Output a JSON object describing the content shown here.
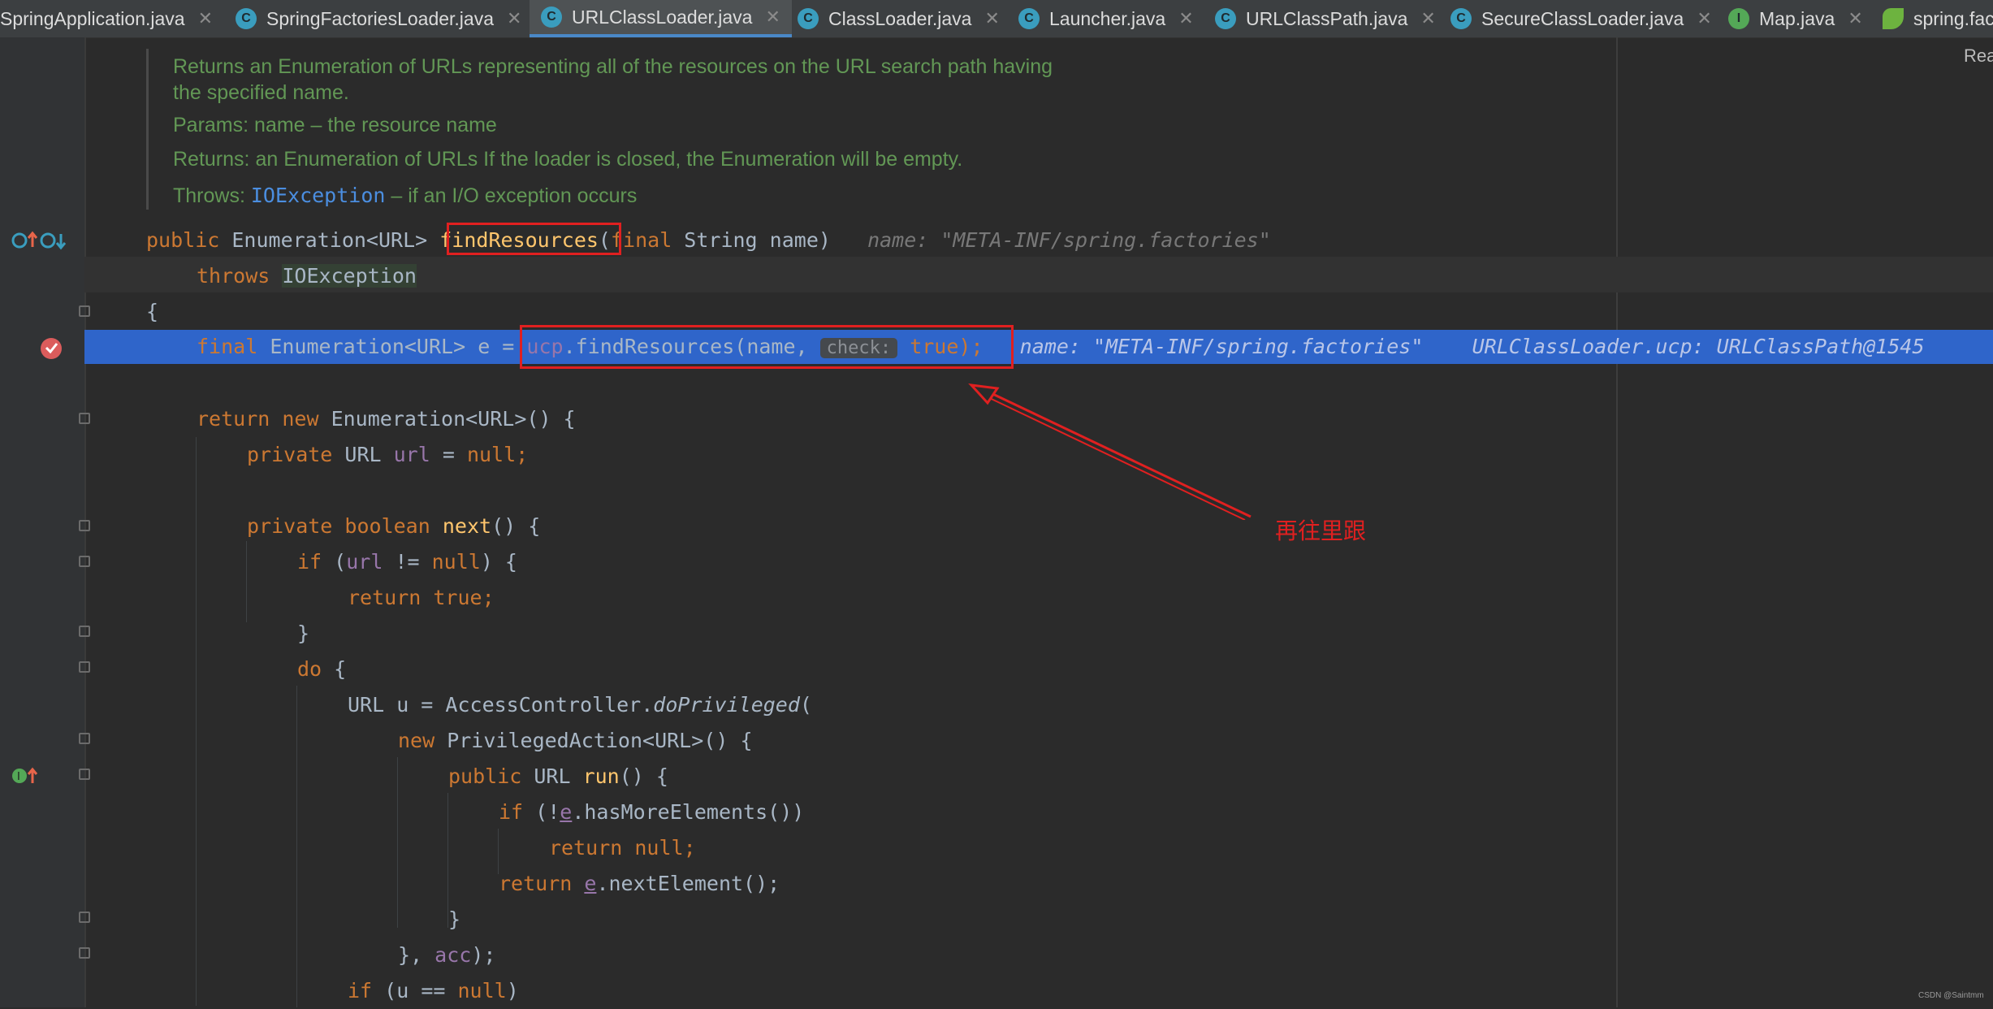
{
  "tabs": [
    {
      "label": "SpringApplication.java",
      "icon": "class-icon",
      "active": false
    },
    {
      "label": "SpringFactoriesLoader.java",
      "icon": "class-icon",
      "active": false
    },
    {
      "label": "URLClassLoader.java",
      "icon": "class-icon",
      "active": true
    },
    {
      "label": "ClassLoader.java",
      "icon": "class-icon",
      "active": false
    },
    {
      "label": "Launcher.java",
      "icon": "class-icon",
      "active": false
    },
    {
      "label": "URLClassPath.java",
      "icon": "class-icon",
      "active": false
    },
    {
      "label": "SecureClassLoader.java",
      "icon": "class-icon",
      "active": false
    },
    {
      "label": "Map.java",
      "icon": "interface-icon",
      "active": false
    },
    {
      "label": "spring.fac",
      "icon": "spring-leaf-icon",
      "active": false
    }
  ],
  "reader_mode_label": "Rea",
  "doc": {
    "summary_line1": "Returns an Enumeration of URLs representing all of the resources on the URL search path having",
    "summary_line2": "the specified name.",
    "params_label": "Params:",
    "params_text": "name – the resource name",
    "returns_label": "Returns:",
    "returns_text": "an Enumeration of URLs If the loader is closed, the Enumeration will be empty.",
    "throws_label": "Throws:",
    "throws_link": "IOException",
    "throws_text": " – if an I/O exception occurs"
  },
  "code": {
    "l1_public": "public",
    "l1_type": " Enumeration<URL> ",
    "l1_method": "findResources",
    "l1_paren": "(",
    "l1_final": "final",
    "l1_params": " String name)",
    "l1_hint": "name: \"META-INF/spring.factories\"",
    "l2_throws": "throws",
    "l2_exc": "IOException",
    "l3": "{",
    "l4_final": "final",
    "l4_decl": " Enumeration<URL> e = ",
    "l4_ucp": "ucp",
    "l4_call": ".findResources(name, ",
    "l4_inlay": "check:",
    "l4_true": "true",
    "l4_end": ");",
    "l4_hint1": "name: \"META-INF/spring.factories\"",
    "l4_hint2": "URLClassLoader.ucp: URLClassPath@1545",
    "l6_return": "return new",
    "l6_rest": " Enumeration<URL>() {",
    "l7_private": "private",
    "l7_type": " URL ",
    "l7_url": "url",
    "l7_eq": " = ",
    "l7_null": "null;",
    "l9_private": "private boolean",
    "l9_next": "next",
    "l9_rest": "() {",
    "l10_if": "if",
    "l10_open": " (",
    "l10_url": "url",
    "l10_ne": " != ",
    "l10_null": "null",
    "l10_close": ") {",
    "l11": "return true;",
    "l12": "}",
    "l13_do": "do",
    "l13_rest": " {",
    "l14_decl": "URL u = AccessController.",
    "l14_method": "doPrivileged",
    "l14_paren": "(",
    "l15_new": "new",
    "l15_rest": " PrivilegedAction<URL>() {",
    "l16_public": "public",
    "l16_type": " URL ",
    "l16_run": "run",
    "l16_rest": "() {",
    "l17_if": "if",
    "l17_open": " (!",
    "l17_e": "e",
    "l17_rest": ".hasMoreElements())",
    "l18": "return null;",
    "l19_return": "return",
    "l19_e": "e",
    "l19_rest": ".nextElement();",
    "l20": "}",
    "l21_close": "}, ",
    "l21_acc": "acc",
    "l21_end": ");",
    "l22_if": "if",
    "l22_rest": " (u == ",
    "l22_null": "null",
    "l22_end": ")"
  },
  "annotation_text": "再往里跟",
  "watermark": "CSDN @Saintmm"
}
